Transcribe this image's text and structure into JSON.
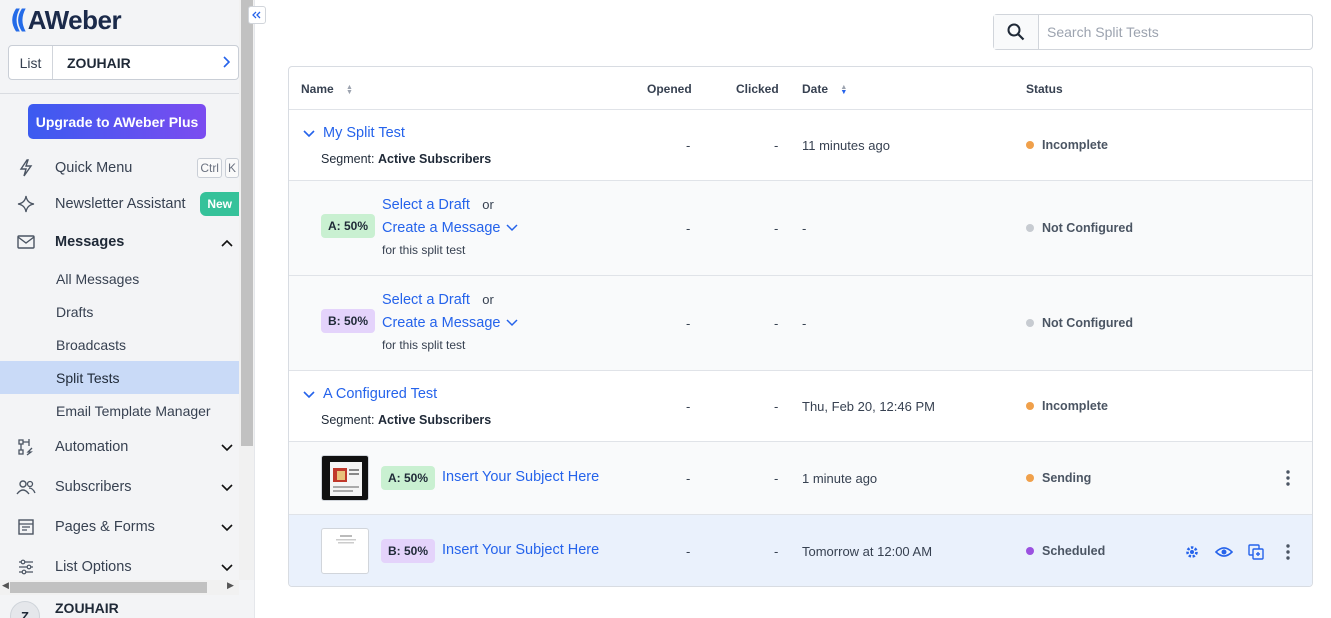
{
  "brand": {
    "name": "AWeber",
    "accent": "#2563eb"
  },
  "list_selector": {
    "label": "List",
    "value": "ZOUHAIR"
  },
  "upgrade": {
    "label": "Upgrade to AWeber Plus"
  },
  "nav": {
    "quick_menu": {
      "label": "Quick Menu",
      "kbd1": "Ctrl",
      "kbd2": "K"
    },
    "newsletter_assistant": {
      "label": "Newsletter Assistant",
      "badge": "New"
    },
    "messages": {
      "label": "Messages"
    },
    "messages_sub": [
      {
        "label": "All Messages"
      },
      {
        "label": "Drafts"
      },
      {
        "label": "Broadcasts"
      },
      {
        "label": "Split Tests"
      },
      {
        "label": "Email Template Manager"
      }
    ],
    "automation": {
      "label": "Automation"
    },
    "subscribers": {
      "label": "Subscribers"
    },
    "pages_forms": {
      "label": "Pages & Forms"
    },
    "list_options": {
      "label": "List Options"
    }
  },
  "user": {
    "initial": "Z",
    "name": "ZOUHAIR"
  },
  "search": {
    "placeholder": "Search Split Tests",
    "value": ""
  },
  "table": {
    "headers": {
      "name": "Name",
      "opened": "Opened",
      "clicked": "Clicked",
      "date": "Date",
      "status": "Status"
    },
    "tests": [
      {
        "name": "My Split Test",
        "segment_label": "Segment:",
        "segment_value": "Active Subscribers",
        "opened": "-",
        "clicked": "-",
        "date": "11 minutes ago",
        "status": "Incomplete",
        "variants": [
          {
            "pill": "A: 50%",
            "select": "Select a Draft",
            "or": "or",
            "create": "Create a Message",
            "note": "for this split test",
            "opened": "-",
            "clicked": "-",
            "date": "-",
            "status": "Not Configured"
          },
          {
            "pill": "B: 50%",
            "select": "Select a Draft",
            "or": "or",
            "create": "Create a Message",
            "note": "for this split test",
            "opened": "-",
            "clicked": "-",
            "date": "-",
            "status": "Not Configured"
          }
        ]
      },
      {
        "name": "A Configured Test",
        "segment_label": "Segment:",
        "segment_value": "Active Subscribers",
        "opened": "-",
        "clicked": "-",
        "date": "Thu, Feb 20, 12:46 PM",
        "status": "Incomplete",
        "variants": [
          {
            "pill": "A: 50%",
            "subject": "Insert Your Subject Here",
            "opened": "-",
            "clicked": "-",
            "date": "1 minute ago",
            "status": "Sending"
          },
          {
            "pill": "B: 50%",
            "subject": "Insert Your Subject Here",
            "opened": "-",
            "clicked": "-",
            "date": "Tomorrow at 12:00 AM",
            "status": "Scheduled"
          }
        ]
      }
    ]
  },
  "status_colors": {
    "Incomplete": "#f0a04b",
    "Not Configured": "#c7cbd1",
    "Sending": "#f0a04b",
    "Scheduled": "#9b51e0"
  }
}
